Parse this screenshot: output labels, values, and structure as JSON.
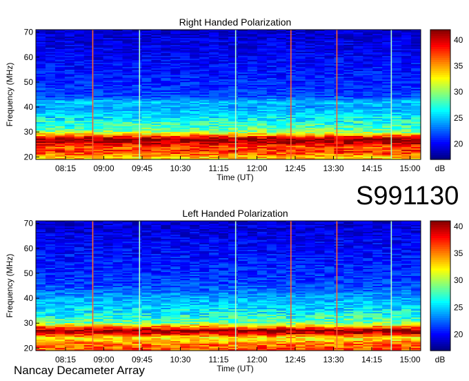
{
  "observation_id": "S991130",
  "instrument": "Nancay Decameter Array",
  "colors": {
    "colormap": [
      "#00007f",
      "#0000ff",
      "#0080ff",
      "#00ffff",
      "#80ff80",
      "#ffff00",
      "#ff8000",
      "#ff0000",
      "#800000"
    ],
    "vertical_markers": [
      "#ff6030",
      "#b0ffd0"
    ]
  },
  "chart_data": [
    {
      "type": "heatmap",
      "title": "Right Handed Polarization",
      "xlabel": "Time (UT)",
      "ylabel": "Frequency (MHz)",
      "x_ticks": [
        "08:15",
        "09:00",
        "09:45",
        "10:30",
        "11:15",
        "12:00",
        "12:45",
        "13:30",
        "14:15",
        "15:00"
      ],
      "y_ticks": [
        20,
        30,
        40,
        50,
        60,
        70
      ],
      "ylim": [
        19,
        71
      ],
      "colorbar": {
        "label": "dB",
        "ticks": [
          20,
          25,
          30,
          35,
          40
        ],
        "range": [
          17,
          42
        ]
      },
      "intensity_profile": {
        "frequency_mhz": [
          20,
          22,
          24,
          26,
          27,
          28,
          30,
          32,
          34,
          36,
          38,
          40,
          42,
          44,
          46,
          50,
          55,
          60,
          65,
          70
        ],
        "level_db": [
          34,
          38,
          37,
          41,
          42,
          38,
          30,
          28,
          27,
          26,
          25,
          24,
          25,
          22,
          21.5,
          21,
          20.5,
          20,
          19.5,
          19
        ]
      },
      "markers": [
        {
          "time": "08:47",
          "type": "red"
        },
        {
          "time": "09:42",
          "type": "light"
        },
        {
          "time": "11:35",
          "type": "light"
        },
        {
          "time": "12:40",
          "type": "red"
        },
        {
          "time": "13:34",
          "type": "red"
        },
        {
          "time": "14:38",
          "type": "light"
        }
      ]
    },
    {
      "type": "heatmap",
      "title": "Left Handed Polarization",
      "xlabel": "Time (UT)",
      "ylabel": "Frequency (MHz)",
      "x_ticks": [
        "08:15",
        "09:00",
        "09:45",
        "10:30",
        "11:15",
        "12:00",
        "12:45",
        "13:30",
        "14:15",
        "15:00"
      ],
      "y_ticks": [
        20,
        30,
        40,
        50,
        60,
        70
      ],
      "ylim": [
        19,
        71
      ],
      "colorbar": {
        "label": "dB",
        "ticks": [
          20,
          25,
          30,
          35,
          40
        ],
        "range": [
          17,
          41
        ]
      },
      "intensity_profile": {
        "frequency_mhz": [
          20,
          22,
          24,
          26,
          27,
          28,
          30,
          32,
          34,
          36,
          38,
          40,
          42,
          44,
          46,
          50,
          55,
          60,
          65,
          70
        ],
        "level_db": [
          36,
          35,
          32,
          39,
          41,
          37,
          29,
          27,
          26,
          25.5,
          24.5,
          24,
          23,
          22,
          21.5,
          21,
          20.5,
          20,
          19.5,
          19
        ]
      },
      "markers": [
        {
          "time": "08:47",
          "type": "red"
        },
        {
          "time": "09:42",
          "type": "light"
        },
        {
          "time": "11:35",
          "type": "light"
        },
        {
          "time": "12:40",
          "type": "red"
        },
        {
          "time": "13:34",
          "type": "red"
        },
        {
          "time": "14:38",
          "type": "light"
        }
      ]
    }
  ]
}
